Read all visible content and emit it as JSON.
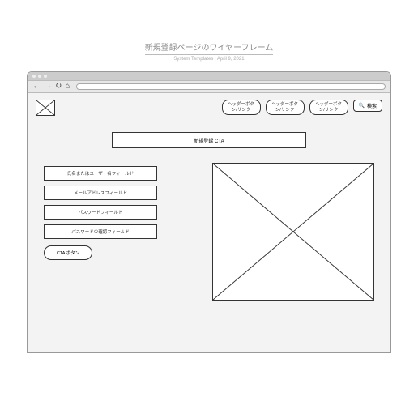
{
  "title": "新規登録ページのワイヤーフレーム",
  "subtitle": "System Templates  |  April 9, 2021",
  "header": {
    "buttons": [
      "ヘッダーボタン/リンク",
      "ヘッダーボタン/リンク",
      "ヘッダーボタン/リンク"
    ],
    "search_label": "検索"
  },
  "main_cta": "新規登録 CTA",
  "form": {
    "fields": [
      "氏名またはユーザー名フィールド",
      "メールアドレスフィールド",
      "パスワードフィールド",
      "パスワードの確認フィールド"
    ],
    "cta_button": "CTA ボタン"
  }
}
